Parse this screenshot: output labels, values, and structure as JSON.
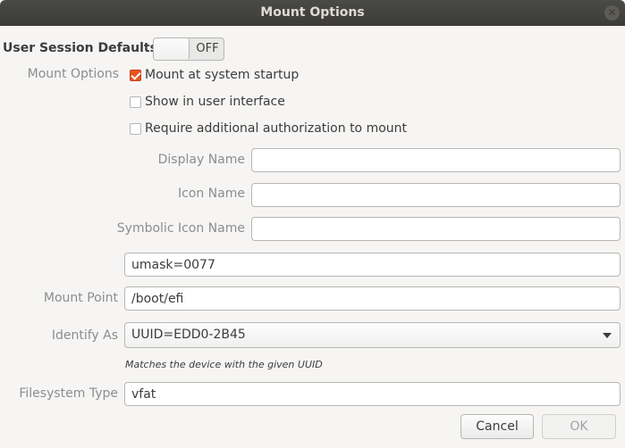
{
  "window": {
    "title": "Mount Options"
  },
  "session": {
    "label": "User Session Defaults",
    "toggle_state": "OFF"
  },
  "options": {
    "label": "Mount Options",
    "mount_at_startup": {
      "label": "Mount at system startup",
      "checked": true
    },
    "show_in_ui": {
      "label": "Show in user interface",
      "checked": false
    },
    "require_auth": {
      "label": "Require additional authorization to mount",
      "checked": false
    }
  },
  "fields": {
    "display_name": {
      "label": "Display Name",
      "value": ""
    },
    "icon_name": {
      "label": "Icon Name",
      "value": ""
    },
    "symbolic_icon_name": {
      "label": "Symbolic Icon Name",
      "value": ""
    },
    "mount_options_value": "umask=0077",
    "mount_point": {
      "label": "Mount Point",
      "value": "/boot/efi"
    },
    "identify_as": {
      "label": "Identify As",
      "value": "UUID=EDD0-2B45",
      "hint": "Matches the device with the given UUID"
    },
    "filesystem_type": {
      "label": "Filesystem Type",
      "value": "vfat"
    }
  },
  "buttons": {
    "cancel": "Cancel",
    "ok": "OK"
  },
  "colors": {
    "accent": "#e95420",
    "titlebar": "#3c3b37"
  }
}
